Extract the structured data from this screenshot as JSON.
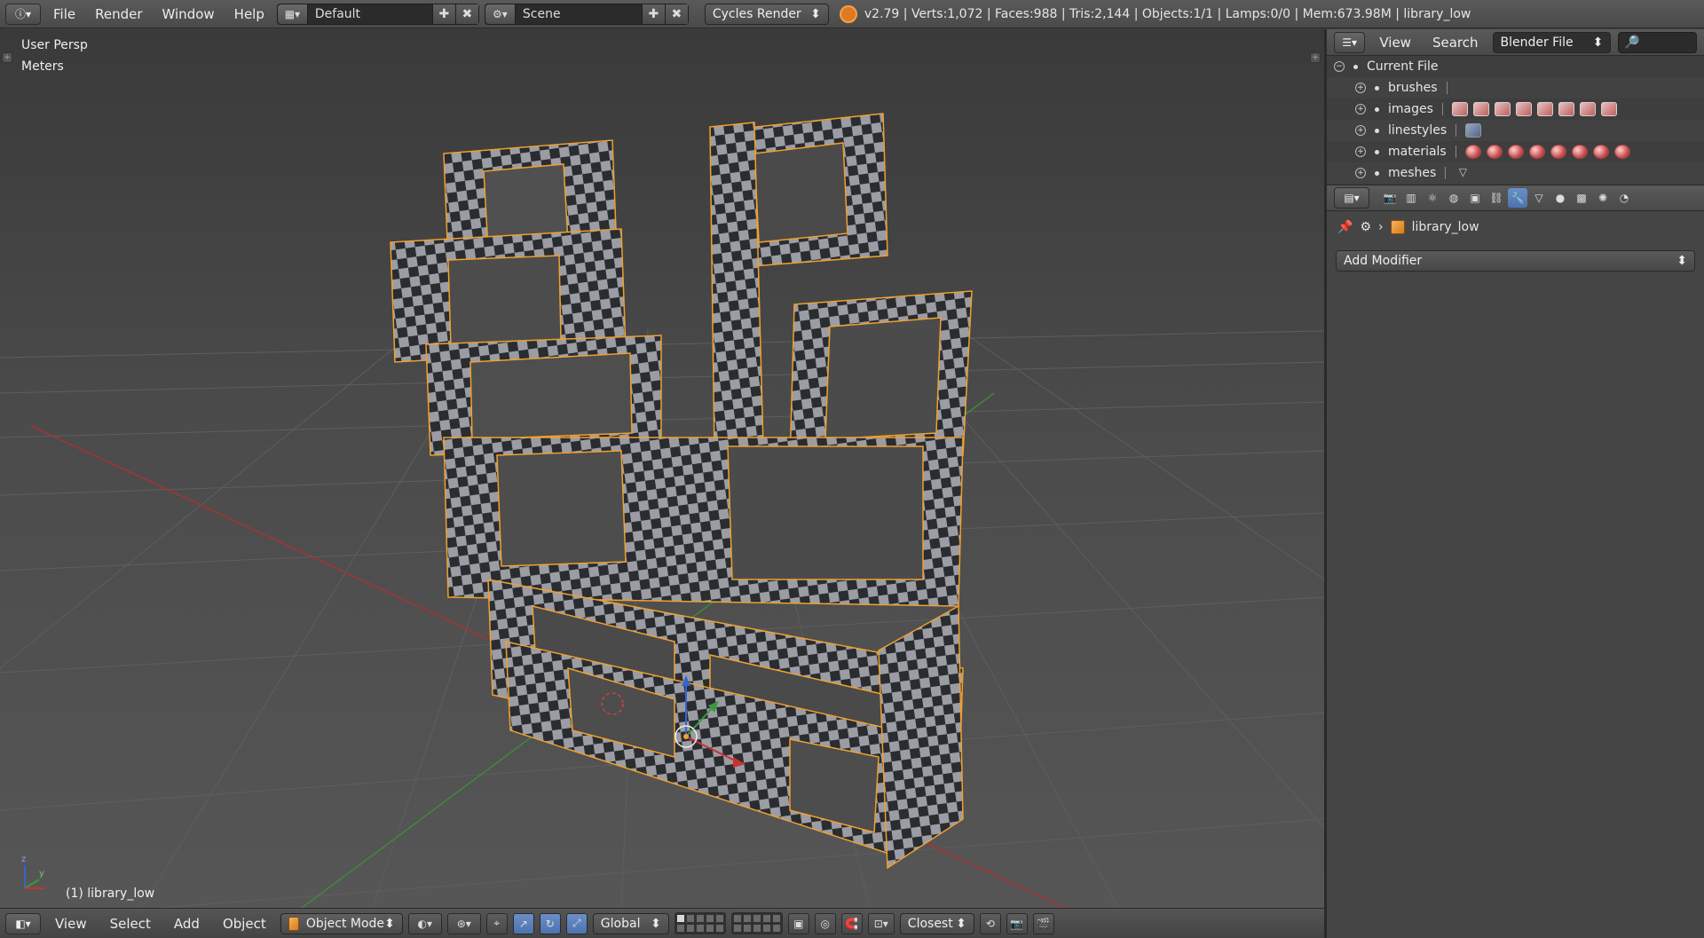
{
  "topbar": {
    "menus": [
      "File",
      "Render",
      "Window",
      "Help"
    ],
    "screen_layout": "Default",
    "scene": "Scene",
    "render_engine": "Cycles Render",
    "stats": "v2.79 | Verts:1,072 | Faces:988 | Tris:2,144 | Objects:1/1 | Lamps:0/0 | Mem:673.98M | library_low"
  },
  "viewport": {
    "view_name": "User Persp",
    "units": "Meters",
    "object_label": "(1) library_low",
    "axis_labels": {
      "z": "z",
      "y": "y",
      "x": "x"
    }
  },
  "bottombar": {
    "menus": [
      "View",
      "Select",
      "Add",
      "Object"
    ],
    "mode": "Object Mode",
    "orientation": "Global",
    "snap": "Closest"
  },
  "outliner": {
    "header_menus": [
      "View",
      "Search"
    ],
    "display_mode": "Blender File",
    "root": "Current File",
    "items": [
      {
        "label": "brushes",
        "icons": []
      },
      {
        "label": "images",
        "icons": [
          "image-icon",
          "image-icon",
          "image-icon",
          "image-icon",
          "image-icon",
          "image-icon",
          "image-icon",
          "image-icon"
        ]
      },
      {
        "label": "linestyles",
        "icons": [
          "linestyle-icon"
        ]
      },
      {
        "label": "materials",
        "icons": [
          "material-icon",
          "material-icon",
          "material-icon",
          "material-icon",
          "material-icon",
          "material-icon",
          "material-icon",
          "material-icon"
        ]
      },
      {
        "label": "meshes",
        "icons": [
          "mesh-icon"
        ]
      }
    ]
  },
  "properties": {
    "object_name": "library_low",
    "add_modifier": "Add Modifier",
    "active_tab": "modifiers"
  },
  "colors": {
    "selection_outline": "#f0a030",
    "active_tab": "#5a7fbd",
    "x_axis": "#c83232",
    "y_axis": "#3c9a3c",
    "z_axis": "#3264d2"
  }
}
